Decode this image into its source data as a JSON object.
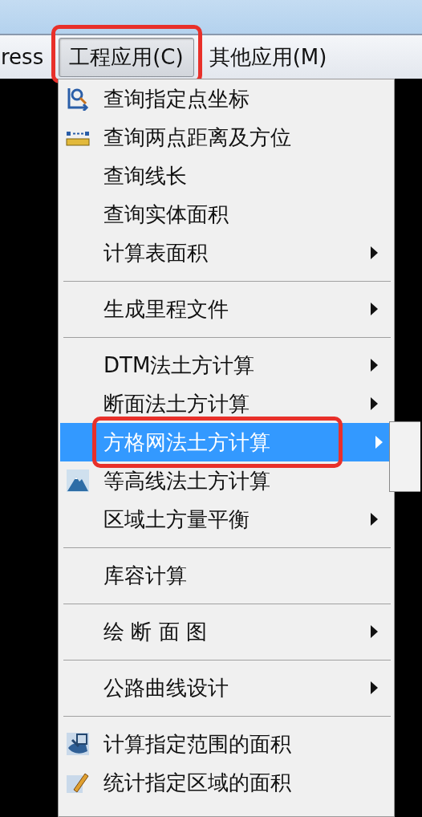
{
  "menubar": [
    {
      "label": "ress",
      "selected": false,
      "annotated": false
    },
    {
      "label": "工程应用(C)",
      "selected": true,
      "annotated": true
    },
    {
      "label": "其他应用(M)",
      "selected": false,
      "annotated": false
    }
  ],
  "menu": {
    "items": [
      {
        "kind": "item",
        "label": "查询指定点坐标",
        "submenu": false,
        "selected": false,
        "annotated": false
      },
      {
        "kind": "item",
        "label": "查询两点距离及方位",
        "submenu": false,
        "selected": false,
        "annotated": false
      },
      {
        "kind": "item",
        "label": "查询线长",
        "submenu": false,
        "selected": false,
        "annotated": false
      },
      {
        "kind": "item",
        "label": "查询实体面积",
        "submenu": false,
        "selected": false,
        "annotated": false
      },
      {
        "kind": "item",
        "label": "计算表面积",
        "submenu": true,
        "selected": false,
        "annotated": false
      },
      {
        "kind": "separator"
      },
      {
        "kind": "item",
        "label": "生成里程文件",
        "submenu": true,
        "selected": false,
        "annotated": false
      },
      {
        "kind": "separator"
      },
      {
        "kind": "item",
        "label": "DTM法土方计算",
        "submenu": true,
        "selected": false,
        "annotated": false
      },
      {
        "kind": "item",
        "label": "断面法土方计算",
        "submenu": true,
        "selected": false,
        "annotated": false
      },
      {
        "kind": "item",
        "label": "方格网法土方计算",
        "submenu": true,
        "selected": true,
        "annotated": true
      },
      {
        "kind": "item",
        "label": "等高线法土方计算",
        "submenu": false,
        "selected": false,
        "annotated": false
      },
      {
        "kind": "item",
        "label": "区域土方量平衡",
        "submenu": true,
        "selected": false,
        "annotated": false
      },
      {
        "kind": "separator"
      },
      {
        "kind": "item",
        "label": "库容计算",
        "submenu": false,
        "selected": false,
        "annotated": false
      },
      {
        "kind": "separator"
      },
      {
        "kind": "item",
        "label": "绘 断 面 图",
        "submenu": true,
        "selected": false,
        "annotated": false
      },
      {
        "kind": "separator"
      },
      {
        "kind": "item",
        "label": "公路曲线设计",
        "submenu": true,
        "selected": false,
        "annotated": false
      },
      {
        "kind": "separator"
      },
      {
        "kind": "item",
        "label": "计算指定范围的面积",
        "submenu": false,
        "selected": false,
        "annotated": false
      },
      {
        "kind": "item",
        "label": "统计指定区域的面积",
        "submenu": false,
        "selected": false,
        "annotated": false
      }
    ]
  }
}
